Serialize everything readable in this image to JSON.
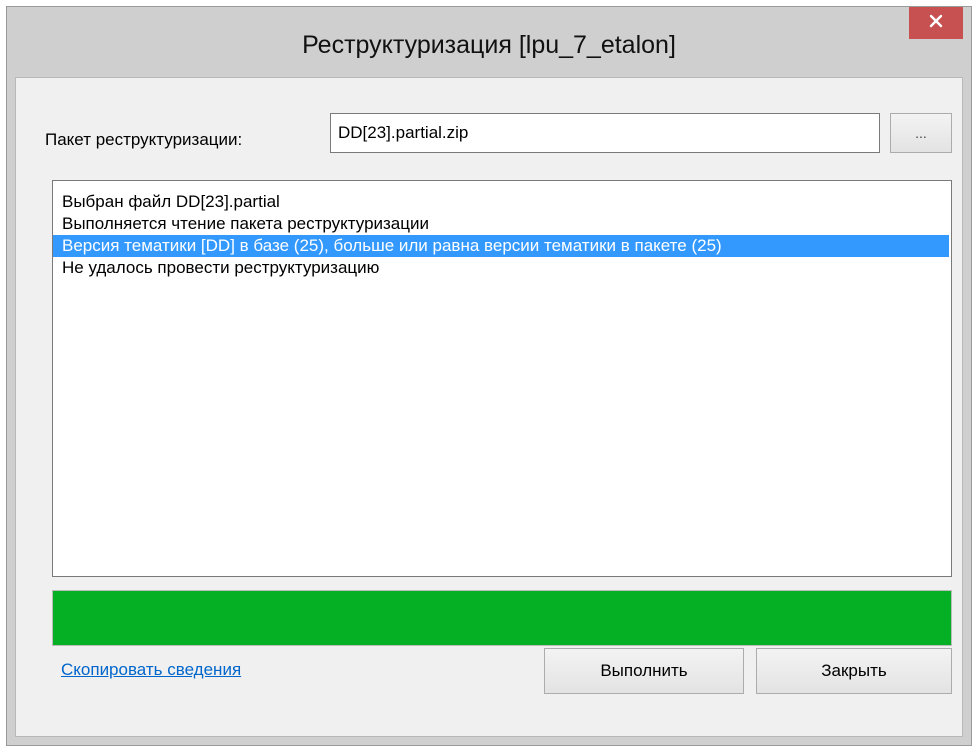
{
  "window": {
    "title": "Реструктуризация [lpu_7_etalon]",
    "close_icon": "close-icon",
    "close_glyph": "✕"
  },
  "package": {
    "label": "Пакет реструктуризации:",
    "value": "DD[23].partial.zip",
    "browse_label": "..."
  },
  "log": {
    "items": [
      {
        "text": "Выбран файл DD[23].partial",
        "selected": false
      },
      {
        "text": "Выполняется чтение пакета реструктуризации",
        "selected": false
      },
      {
        "text": "Версия тематики [DD] в базе (25), больше или равна версии тематики в пакете (25)",
        "selected": true
      },
      {
        "text": "Не удалось провести реструктуризацию",
        "selected": false
      }
    ]
  },
  "progress": {
    "value_percent": 100,
    "color": "#06b025"
  },
  "footer": {
    "copy_link": "Скопировать сведения",
    "run_label": "Выполнить",
    "close_label": "Закрыть"
  }
}
